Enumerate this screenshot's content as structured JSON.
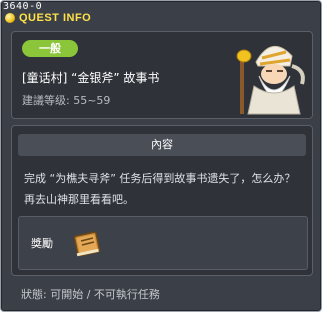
{
  "window": {
    "quest_id": "3640-0",
    "title": "QUEST INFO"
  },
  "header": {
    "category": "一般",
    "quest_name": "[童话村] “金银斧” 故事书",
    "level_label": "建議等级:",
    "level_range": "55~59",
    "npc_icon": "old-mountain-god-icon"
  },
  "content": {
    "section_title": "內容",
    "description": "完成 “为樵夫寻斧” 任务后得到故事书遗失了，怎么办？再去山神那里看看吧。",
    "reward_label": "獎勵",
    "reward_item_icon": "storybook-icon"
  },
  "status": {
    "label": "狀態:",
    "value": "可開始 / 不可執行任務"
  },
  "colors": {
    "title_yellow": "#ffe14a",
    "badge_green": "#8bc63a",
    "panel_bg": "#2f3239",
    "window_bg": "#3b3f47"
  }
}
